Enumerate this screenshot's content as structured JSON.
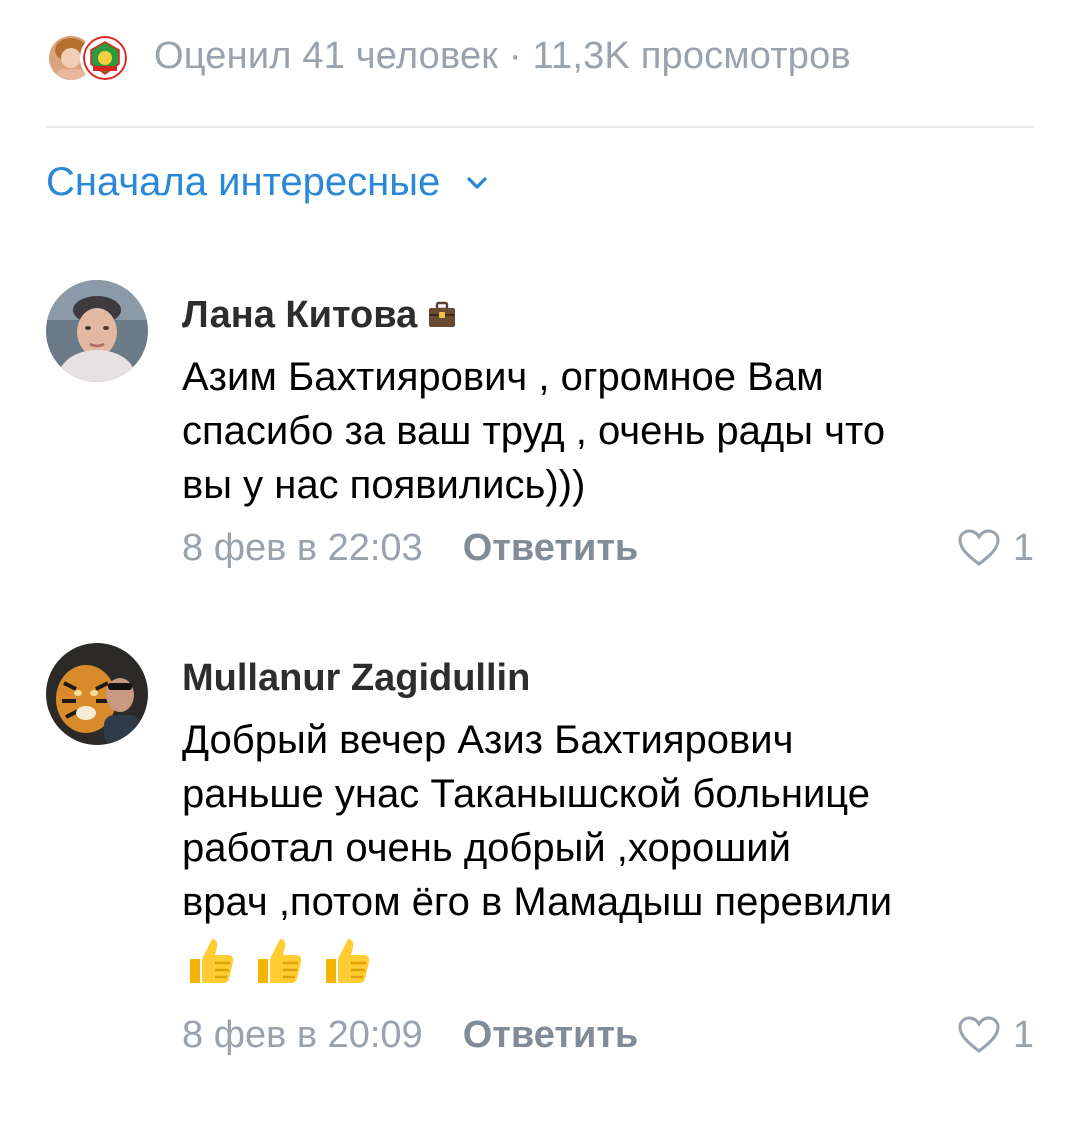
{
  "stats": {
    "text": "Оценил 41 человек · 11,3K просмотров"
  },
  "sort": {
    "label": "Сначала интересные"
  },
  "comments": [
    {
      "author": "Лана Китова",
      "text_lines": [
        "Азим Бахтиярович , огромное Вам",
        "спасибо за ваш труд , очень рады что",
        "вы у нас появились)))"
      ],
      "time": "8 фев в 22:03",
      "reply_label": "Ответить",
      "likes": "1"
    },
    {
      "author": "Mullanur Zagidullin",
      "text_lines": [
        "Добрый вечер Азиз Бахтиярович",
        "раньше унас Таканышской больнице",
        "работал очень добрый ,хороший",
        "врач ,потом ёго в Мамадыш перевили"
      ],
      "emoji": "👍👍👍",
      "time": "8 фев в 20:09",
      "reply_label": "Ответить",
      "likes": "1"
    }
  ],
  "colors": {
    "accent": "#2a88d8",
    "secondary_text": "#99a2ad",
    "action_text": "#818c99",
    "divider": "#e7e8ec"
  }
}
